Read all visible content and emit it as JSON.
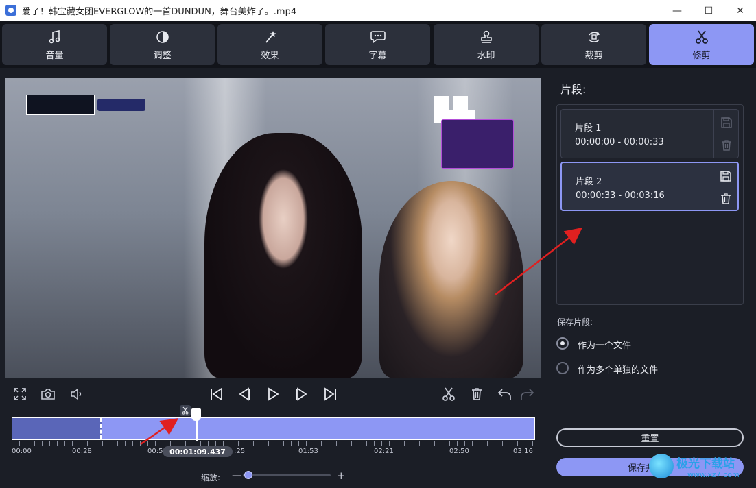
{
  "window": {
    "title": "爱了！韩宝藏女团EVERGLOW的一首DUNDUN，舞台美炸了。.mp4",
    "minimize": "—",
    "maximize": "☐",
    "close": "✕"
  },
  "toolbar": {
    "tabs": [
      {
        "label": "音量",
        "icon": "music-note-icon"
      },
      {
        "label": "调整",
        "icon": "contrast-icon"
      },
      {
        "label": "效果",
        "icon": "magic-wand-icon"
      },
      {
        "label": "字幕",
        "icon": "speech-bubble-icon"
      },
      {
        "label": "水印",
        "icon": "stamp-icon"
      },
      {
        "label": "裁剪",
        "icon": "crop-rotate-icon"
      },
      {
        "label": "修剪",
        "icon": "scissors-icon"
      }
    ],
    "active_tab": "修剪"
  },
  "timeline": {
    "tick_labels": [
      "00:00",
      "00:28",
      "00:5",
      ":25",
      "01:53",
      "02:21",
      "02:50",
      "03:16"
    ],
    "current_time": "00:01:09.437",
    "zoom_label": "缩放:",
    "zoom_minus": "—",
    "zoom_plus": "+",
    "zoom_level": 0.03,
    "first_segment_end": 0.17,
    "playhead_position": 0.352
  },
  "panel": {
    "title": "片段:",
    "clips": [
      {
        "name": "片段 1",
        "range": "00:00:00 - 00:00:33",
        "selected": false
      },
      {
        "name": "片段 2",
        "range": "00:00:33 - 00:03:16",
        "selected": true
      }
    ],
    "save_clips_label": "保存片段:",
    "options": [
      {
        "label": "作为一个文件",
        "checked": true
      },
      {
        "label": "作为多个单独的文件",
        "checked": false
      }
    ],
    "reset_label": "重置",
    "save_close_label": "保存并关闭"
  },
  "watermark": {
    "text": "极光下载站",
    "sub": "www.xz7.com"
  },
  "colors": {
    "accent": "#8d97f4",
    "background": "#1b1e26",
    "tab_bg": "#2c303b",
    "arrow": "#e02020"
  }
}
